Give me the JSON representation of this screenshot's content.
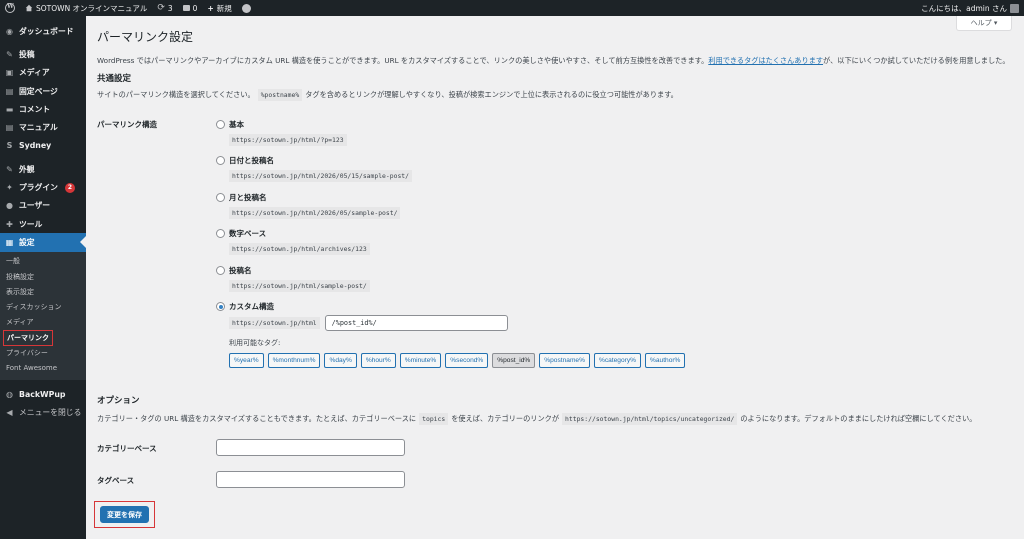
{
  "adminbar": {
    "site_name": "SOTOWN オンラインマニュアル",
    "updates_count": "3",
    "comments_count": "0",
    "new_label": "新規",
    "greeting": "こんにちは、admin さん"
  },
  "sidebar": {
    "items": [
      {
        "label": "ダッシュボード",
        "icon": "dashboard-icon",
        "glyph": "◉"
      },
      {
        "label": "投稿",
        "icon": "pin-icon",
        "glyph": "✎"
      },
      {
        "label": "メディア",
        "icon": "media-icon",
        "glyph": "▣"
      },
      {
        "label": "固定ページ",
        "icon": "page-icon",
        "glyph": "▤"
      },
      {
        "label": "コメント",
        "icon": "comment-icon",
        "glyph": "▬"
      },
      {
        "label": "マニュアル",
        "icon": "manual-icon",
        "glyph": "▤"
      },
      {
        "label": "Sydney",
        "icon": "sydney-icon",
        "glyph": "S"
      },
      {
        "label": "外観",
        "icon": "appearance-icon",
        "glyph": "✎"
      },
      {
        "label": "プラグイン",
        "icon": "plugin-icon",
        "glyph": "✦",
        "badge": "2"
      },
      {
        "label": "ユーザー",
        "icon": "user-icon",
        "glyph": "●"
      },
      {
        "label": "ツール",
        "icon": "tool-icon",
        "glyph": "✚"
      },
      {
        "label": "設定",
        "icon": "settings-icon",
        "glyph": "▦"
      }
    ],
    "submenu": [
      "一般",
      "投稿設定",
      "表示設定",
      "ディスカッション",
      "メディア",
      "パーマリンク",
      "プライバシー",
      "Font Awesome"
    ],
    "backwpup": "BackWPup",
    "collapse": "メニューを閉じる"
  },
  "help_label": "ヘルプ ▾",
  "page_title": "パーマリンク設定",
  "intro": {
    "before": "WordPress ではパーマリンクやアーカイブにカスタム URL 構造を使うことができます。URL をカスタマイズすることで、リンクの美しさや使いやすさ、そして前方互換性を改善できます。",
    "link": "利用できるタグはたくさんあります",
    "after": "が、以下にいくつか試していただける例を用意しました。"
  },
  "common": {
    "heading": "共通設定",
    "desc_before": "サイトのパーマリンク構造を選択してください。",
    "desc_code": "%postname%",
    "desc_after": "タグを含めるとリンクが理解しやすくなり、投稿が検索エンジンで上位に表示されるのに役立つ可能性があります。",
    "row_label": "パーマリンク構造",
    "options": [
      {
        "label": "基本",
        "sample": "https://sotown.jp/html/?p=123"
      },
      {
        "label": "日付と投稿名",
        "sample": "https://sotown.jp/html/2026/05/15/sample-post/"
      },
      {
        "label": "月と投稿名",
        "sample": "https://sotown.jp/html/2026/05/sample-post/"
      },
      {
        "label": "数字ベース",
        "sample": "https://sotown.jp/html/archives/123"
      },
      {
        "label": "投稿名",
        "sample": "https://sotown.jp/html/sample-post/"
      },
      {
        "label": "カスタム構造"
      }
    ],
    "selected_option": "カスタム構造",
    "custom_prefix": "https://sotown.jp/html",
    "custom_value": "/%post_id%/",
    "available_tags_label": "利用可能なタグ:",
    "tags": [
      "%year%",
      "%monthnum%",
      "%day%",
      "%hour%",
      "%minute%",
      "%second%",
      "%post_id%",
      "%postname%",
      "%category%",
      "%author%"
    ],
    "active_tag": "%post_id%"
  },
  "options": {
    "heading": "オプション",
    "desc_before": "カテゴリー・タグの URL 構造をカスタマイズすることもできます。たとえば、カテゴリーベースに",
    "desc_code1": "topics",
    "desc_mid": "を使えば、カテゴリーのリンクが",
    "desc_code2": "https://sotown.jp/html/topics/uncategorized/",
    "desc_after": "のようになります。デフォルトのままにしたければ空欄にしてください。",
    "category_base_label": "カテゴリーベース",
    "category_base_value": "",
    "tag_base_label": "タグベース",
    "tag_base_value": ""
  },
  "save_label": "変更を保存"
}
